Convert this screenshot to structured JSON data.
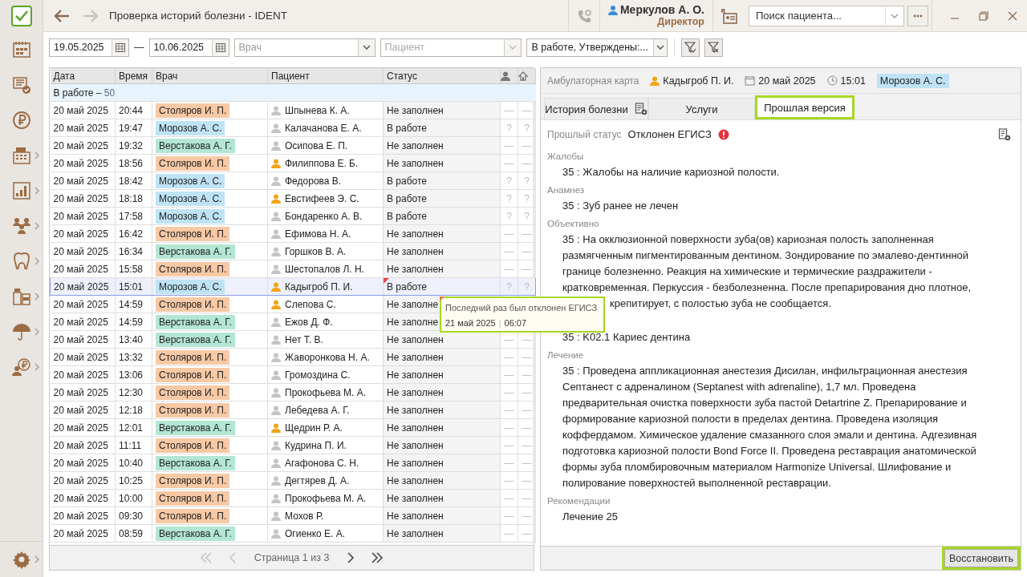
{
  "sidebar": {
    "items": [
      {
        "expandable": false
      },
      {
        "expandable": false
      },
      {
        "expandable": false
      },
      {
        "expandable": true
      },
      {
        "expandable": true
      },
      {
        "expandable": true
      },
      {
        "expandable": true
      },
      {
        "expandable": true
      },
      {
        "expandable": true
      },
      {
        "expandable": true
      }
    ],
    "footer_items": [
      {
        "expandable": true
      }
    ]
  },
  "window": {
    "title": "Проверка историй болезни - IDENT",
    "user_name": "Меркулов А. О.",
    "user_role": "Директор",
    "search": {
      "placeholder": "Поиск пациента..."
    },
    "back_enabled": true,
    "forward_enabled": false
  },
  "filters": {
    "date_from": "19.05.2025",
    "separator": "—",
    "date_to": "10.06.2025",
    "doctor": {
      "placeholder": "Врач"
    },
    "patient": {
      "placeholder": "Пациент"
    },
    "status": "В работе, Утверждены:..."
  },
  "table": {
    "columns": [
      "Дата",
      "Время",
      "Врач",
      "Пациент",
      "Статус"
    ],
    "group": {
      "label": "В работе –",
      "count": "50"
    },
    "rows": [
      {
        "date": "20 май 2025",
        "time": "20:44",
        "doctor": "Столяров И. П.",
        "color": "#f8c9a5",
        "patient": "Шпынева К. А.",
        "patient_flagged": false,
        "status": "Не заполнен",
        "mark_1": "—",
        "mark_2": "—",
        "selected": false,
        "rejected": false
      },
      {
        "date": "20 май 2025",
        "time": "19:47",
        "doctor": "Морозов А. С.",
        "color": "#bfe3f6",
        "patient": "Калачанова Е. А.",
        "patient_flagged": false,
        "status": "В работе",
        "mark_1": "?",
        "mark_2": "?",
        "selected": false,
        "rejected": false
      },
      {
        "date": "20 май 2025",
        "time": "19:32",
        "doctor": "Верстакова А. Г.",
        "color": "#b3e6d3",
        "patient": "Осипова Е. П.",
        "patient_flagged": false,
        "status": "Не заполнен",
        "mark_1": "—",
        "mark_2": "—",
        "selected": false,
        "rejected": false
      },
      {
        "date": "20 май 2025",
        "time": "18:56",
        "doctor": "Столяров И. П.",
        "color": "#f8c9a5",
        "patient": "Филиппова Е. Б.",
        "patient_flagged": true,
        "status": "Не заполнен",
        "mark_1": "—",
        "mark_2": "—",
        "selected": false,
        "rejected": false
      },
      {
        "date": "20 май 2025",
        "time": "18:42",
        "doctor": "Морозов А. С.",
        "color": "#bfe3f6",
        "patient": "Федорова В.",
        "patient_flagged": false,
        "status": "В работе",
        "mark_1": "?",
        "mark_2": "?",
        "selected": false,
        "rejected": false
      },
      {
        "date": "20 май 2025",
        "time": "18:18",
        "doctor": "Морозов А. С.",
        "color": "#bfe3f6",
        "patient": "Евстифеев Э. С.",
        "patient_flagged": true,
        "status": "В работе",
        "mark_1": "?",
        "mark_2": "?",
        "selected": false,
        "rejected": false
      },
      {
        "date": "20 май 2025",
        "time": "17:58",
        "doctor": "Морозов А. С.",
        "color": "#bfe3f6",
        "patient": "Бондаренко А. В.",
        "patient_flagged": false,
        "status": "В работе",
        "mark_1": "?",
        "mark_2": "?",
        "selected": false,
        "rejected": false
      },
      {
        "date": "20 май 2025",
        "time": "16:42",
        "doctor": "Столяров И. П.",
        "color": "#f8c9a5",
        "patient": "Ефимова Н. А.",
        "patient_flagged": false,
        "status": "Не заполнен",
        "mark_1": "—",
        "mark_2": "—",
        "selected": false,
        "rejected": false
      },
      {
        "date": "20 май 2025",
        "time": "16:34",
        "doctor": "Верстакова А. Г.",
        "color": "#b3e6d3",
        "patient": "Горшков В. А.",
        "patient_flagged": false,
        "status": "Не заполнен",
        "mark_1": "—",
        "mark_2": "—",
        "selected": false,
        "rejected": false
      },
      {
        "date": "20 май 2025",
        "time": "15:58",
        "doctor": "Столяров И. П.",
        "color": "#f8c9a5",
        "patient": "Шестопалов Л. Н.",
        "patient_flagged": false,
        "status": "Не заполнен",
        "mark_1": "—",
        "mark_2": "—",
        "selected": false,
        "rejected": false
      },
      {
        "date": "20 май 2025",
        "time": "15:01",
        "doctor": "Морозов А. С.",
        "color": "#bfe3f6",
        "patient": "Кадыгроб П. И.",
        "patient_flagged": true,
        "status": "В работе",
        "mark_1": "?",
        "mark_2": "?",
        "selected": true,
        "rejected": true
      },
      {
        "date": "20 май 2025",
        "time": "14:59",
        "doctor": "Столяров И. П.",
        "color": "#f8c9a5",
        "patient": "Слепова С.",
        "patient_flagged": true,
        "status": "Не заполне",
        "selected": false,
        "rejected": false
      },
      {
        "date": "20 май 2025",
        "time": "14:59",
        "doctor": "Верстакова А. Г.",
        "color": "#b3e6d3",
        "patient": "Ежов Д. Ф.",
        "patient_flagged": false,
        "status": "Не заполне",
        "selected": false,
        "rejected": false
      },
      {
        "date": "20 май 2025",
        "time": "13:40",
        "doctor": "Верстакова А. Г.",
        "color": "#b3e6d3",
        "patient": "Нет Т. В.",
        "patient_flagged": false,
        "status": "Не заполнен",
        "mark_1": "—",
        "mark_2": "—",
        "selected": false,
        "rejected": false
      },
      {
        "date": "20 май 2025",
        "time": "13:32",
        "doctor": "Столяров И. П.",
        "color": "#f8c9a5",
        "patient": "Жаворонкова Н. А.",
        "patient_flagged": false,
        "status": "Не заполнен",
        "mark_1": "—",
        "mark_2": "—",
        "selected": false,
        "rejected": false
      },
      {
        "date": "20 май 2025",
        "time": "13:06",
        "doctor": "Столяров И. П.",
        "color": "#f8c9a5",
        "patient": "Громоздина С.",
        "patient_flagged": false,
        "status": "Не заполнен",
        "mark_1": "—",
        "mark_2": "—",
        "selected": false,
        "rejected": false
      },
      {
        "date": "20 май 2025",
        "time": "12:30",
        "doctor": "Столяров И. П.",
        "color": "#f8c9a5",
        "patient": "Прокофьева М. А.",
        "patient_flagged": false,
        "status": "Не заполнен",
        "mark_1": "—",
        "mark_2": "—",
        "selected": false,
        "rejected": false
      },
      {
        "date": "20 май 2025",
        "time": "12:18",
        "doctor": "Столяров И. П.",
        "color": "#f8c9a5",
        "patient": "Лебедева А. Г.",
        "patient_flagged": false,
        "status": "Не заполнен",
        "mark_1": "—",
        "mark_2": "—",
        "selected": false,
        "rejected": false
      },
      {
        "date": "20 май 2025",
        "time": "12:01",
        "doctor": "Верстакова А. Г.",
        "color": "#b3e6d3",
        "patient": "Щедрин Р. А.",
        "patient_flagged": true,
        "status": "Не заполнен",
        "mark_1": "—",
        "mark_2": "—",
        "selected": false,
        "rejected": false
      },
      {
        "date": "20 май 2025",
        "time": "11:11",
        "doctor": "Столяров И. П.",
        "color": "#f8c9a5",
        "patient": "Кудрина П. И.",
        "patient_flagged": false,
        "status": "Не заполнен",
        "mark_1": "—",
        "mark_2": "—",
        "selected": false,
        "rejected": false
      },
      {
        "date": "20 май 2025",
        "time": "10:40",
        "doctor": "Верстакова А. Г.",
        "color": "#b3e6d3",
        "patient": "Агафонова С. Н.",
        "patient_flagged": false,
        "status": "Не заполнен",
        "mark_1": "—",
        "mark_2": "—",
        "selected": false,
        "rejected": false
      },
      {
        "date": "20 май 2025",
        "time": "10:25",
        "doctor": "Столяров И. П.",
        "color": "#f8c9a5",
        "patient": "Дегтярев Д. А.",
        "patient_flagged": false,
        "status": "Не заполнен",
        "mark_1": "—",
        "mark_2": "—",
        "selected": false,
        "rejected": false
      },
      {
        "date": "20 май 2025",
        "time": "10:00",
        "doctor": "Столяров И. П.",
        "color": "#f8c9a5",
        "patient": "Прокофьева М. А.",
        "patient_flagged": false,
        "status": "Не заполнен",
        "mark_1": "—",
        "mark_2": "—",
        "selected": false,
        "rejected": false
      },
      {
        "date": "20 май 2025",
        "time": "09:30",
        "doctor": "Столяров И. П.",
        "color": "#f8c9a5",
        "patient": "Мохов Р.",
        "patient_flagged": false,
        "status": "Не заполнен",
        "mark_1": "—",
        "mark_2": "—",
        "selected": false,
        "rejected": false
      },
      {
        "date": "20 май 2025",
        "time": "08:59",
        "doctor": "Верстакова А. Г.",
        "color": "#b3e6d3",
        "patient": "Огиенко Е. А.",
        "patient_flagged": false,
        "status": "Не заполнен",
        "mark_1": "—",
        "mark_2": "—",
        "selected": false,
        "rejected": false
      }
    ],
    "pager": {
      "label": "Страница 1 из 3",
      "first_enabled": false,
      "prev_enabled": false,
      "next_enabled": true,
      "last_enabled": true
    }
  },
  "tooltip": {
    "title": "Последний раз был отклонен ЕГИСЗ",
    "date": "21 май 2025",
    "separator": "|",
    "time": "06:07"
  },
  "record": {
    "header_label": "Амбулаторная карта",
    "patient": "Кадыгроб П. И.",
    "date": "20 май 2025",
    "time": "15:01",
    "doctor": {
      "name": "Морозов А. С.",
      "color": "#bfe3f6"
    },
    "tabs": [
      {
        "label": "История болезни",
        "selected": false,
        "has_icon": true
      },
      {
        "label": "Услуги",
        "selected": false,
        "has_icon": false
      },
      {
        "label": "Прошлая версия",
        "selected": true,
        "has_icon": false
      }
    ],
    "previous_status_label": "Прошлый статус",
    "previous_status": "Отклонен ЕГИСЗ",
    "sections": [
      {
        "label": "Жалобы",
        "texts": [
          "35 : Жалобы на наличие кариозной полости."
        ]
      },
      {
        "label": "Анамнез",
        "texts": [
          "35 : Зуб ранее не лечен"
        ]
      },
      {
        "label": "Объективно",
        "texts": [
          "35 : На окклюзионной поверхности зуба(ов) кариозная полость заполненная размягченным пигментированным дентином. Зондирование по эмалево-дентинной границе болезненно. Реакция на химические и термические раздражители - кратковременная. Перкуссия - безболезненна. После препарирования дно плотное,",
          "крепитирует, с полостью зуба не сообщается."
        ]
      },
      {
        "texts": [
          "35 : K02.1 Кариес дентина"
        ]
      },
      {
        "label": "Лечение",
        "texts": [
          "35 : Проведена аппликационная анестезия Дисилан, инфильтрационная анестезия Септанест с адреналином (Septanest with adrenaline), 1,7 мл. Проведена предварительная очистка поверхности зуба пастой Detartrine Z. Препарирование и формирование кариозной полости в пределах дентина. Проведена изоляция коффердамом. Химическое удаление смазанного слоя эмали и дентина. Адгезивная подготовка кариозной полости Bond Force II. Проведена реставрация анатомической формы зуба пломбировочным материалом Harmonize Universal. Шлифование и полирование поверхностей выполненной реставрации."
        ]
      },
      {
        "label": "Рекомендации",
        "texts": [
          "Лечение 25"
        ]
      }
    ],
    "restore_button": "Восстановить"
  }
}
